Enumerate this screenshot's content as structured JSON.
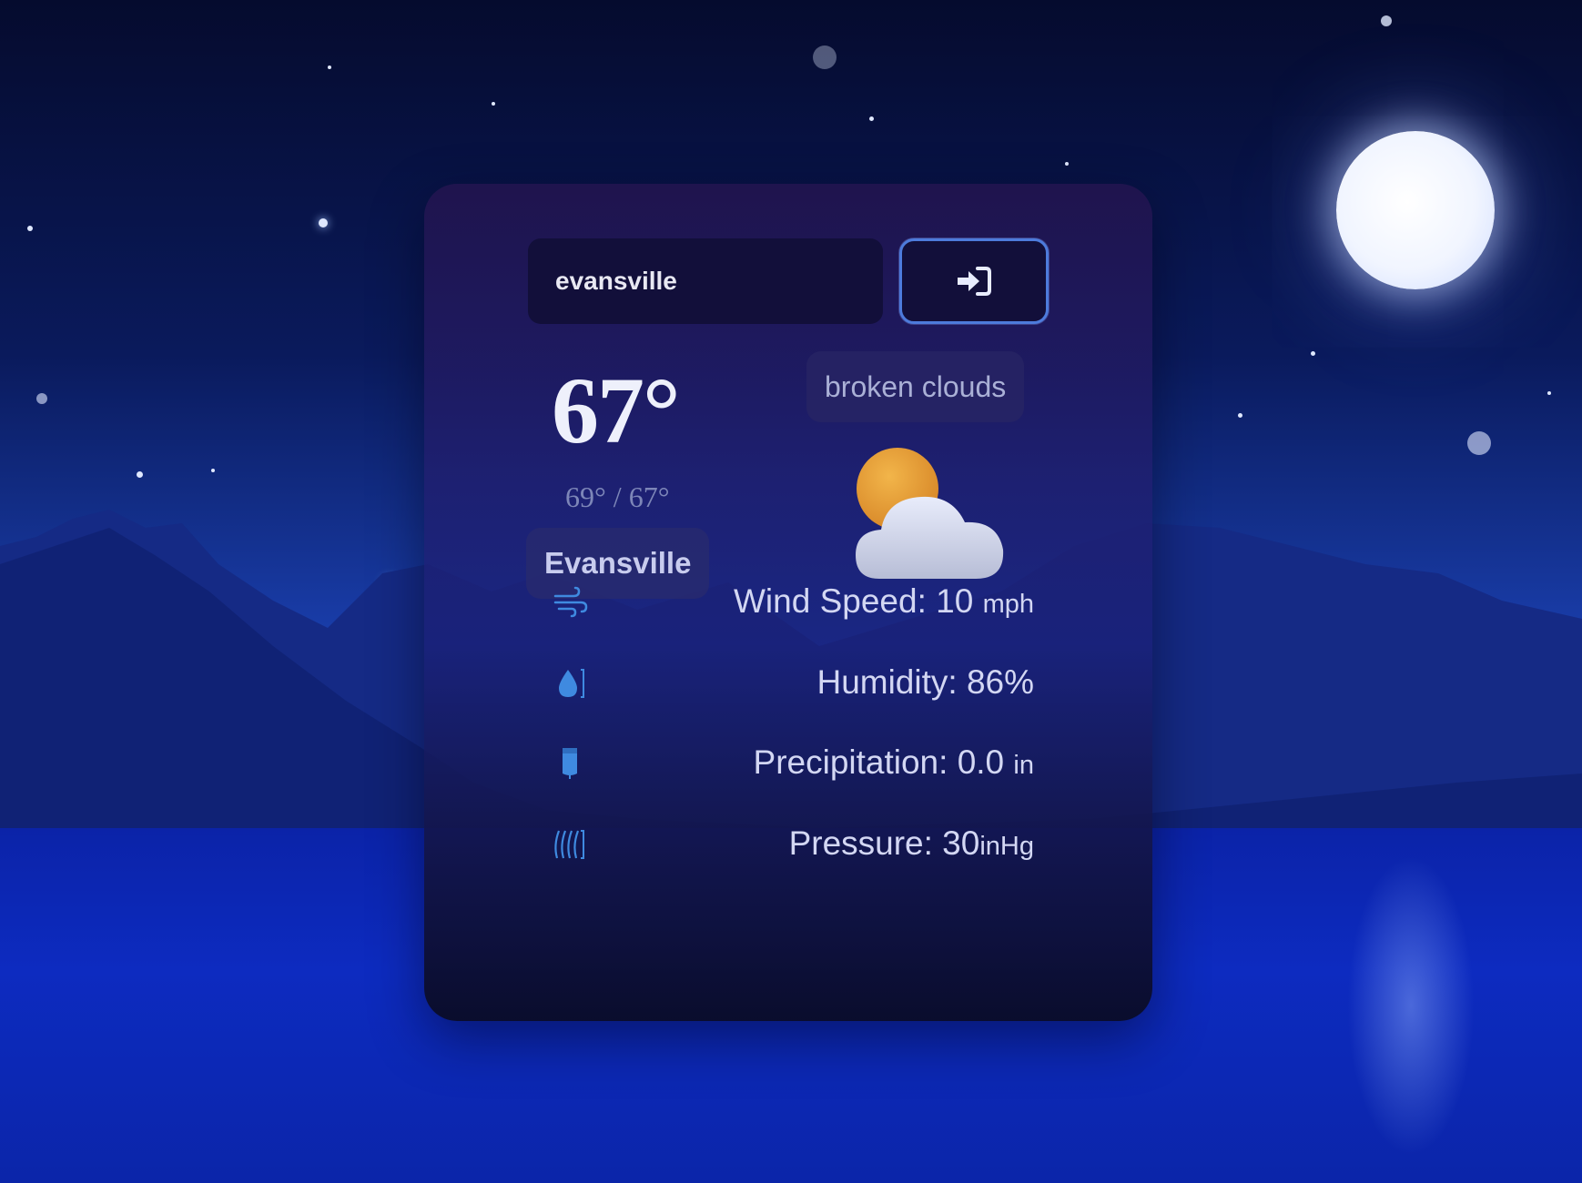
{
  "search": {
    "value": "evansville"
  },
  "weather": {
    "temperature": "67°",
    "high_low": "69° / 67°",
    "city": "Evansville",
    "description": "broken clouds",
    "icon": "partly-cloudy-icon"
  },
  "stats": {
    "wind": {
      "label": "Wind Speed: 10",
      "unit": "mph",
      "icon": "wind-icon"
    },
    "humidity": {
      "label": "Humidity: 86%",
      "icon": "humidity-icon"
    },
    "precipitation": {
      "label": "Precipitation: 0.0",
      "unit": "in",
      "icon": "precipitation-icon"
    },
    "pressure": {
      "label": "Pressure: 30",
      "unit": "inHg",
      "icon": "pressure-icon"
    }
  },
  "colors": {
    "accent": "#4d7bdc",
    "icon_blue": "#3f8ae0"
  }
}
